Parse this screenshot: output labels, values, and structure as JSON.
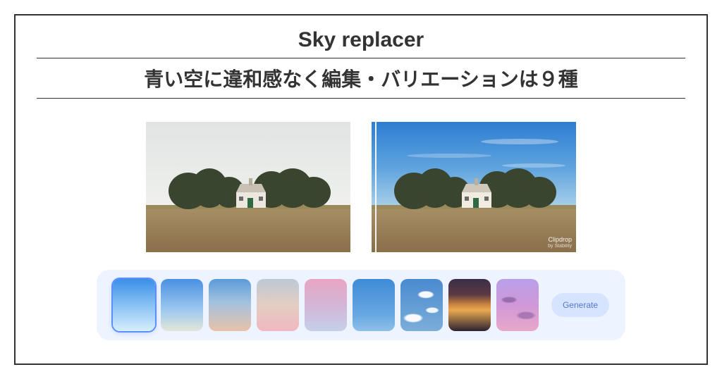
{
  "title": "Sky replacer",
  "subtitle": "青い空に違和感なく編集・バリエーションは９種",
  "watermark": {
    "line1": "Clipdrop",
    "line2": "by Stability"
  },
  "palette": {
    "generate_label": "Generate",
    "selected_index": 0,
    "swatches": [
      {
        "name": "clear-blue",
        "colors": [
          "#3b8fe8",
          "#d8eefc"
        ]
      },
      {
        "name": "blue-horizon",
        "colors": [
          "#4a90e2",
          "#e2e6d8"
        ]
      },
      {
        "name": "blue-to-peach",
        "colors": [
          "#5a9bd8",
          "#e8c2a8"
        ]
      },
      {
        "name": "pale-dusk",
        "colors": [
          "#bcc9d6",
          "#f0b8c2"
        ]
      },
      {
        "name": "pink-lavender",
        "colors": [
          "#e8a5c2",
          "#c5d0e8"
        ]
      },
      {
        "name": "deep-blue",
        "colors": [
          "#3f8bd8",
          "#8fc0ea"
        ]
      },
      {
        "name": "clouds",
        "colors": [
          "#4a8ad0",
          "#7baed8"
        ]
      },
      {
        "name": "sunset",
        "colors": [
          "#3a2d4a",
          "#e8a850"
        ]
      },
      {
        "name": "purple-clouds",
        "colors": [
          "#b8a0e8",
          "#e8a8c8"
        ]
      }
    ]
  }
}
